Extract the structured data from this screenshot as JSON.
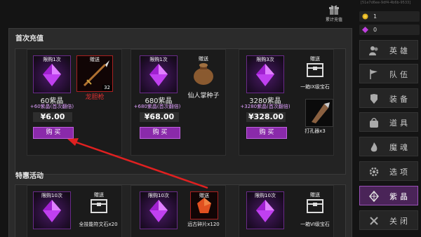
{
  "header": {
    "id_text": "[51e7d6ee-9df4-4b6b-9533]",
    "cumulative_label": "累计充值"
  },
  "currency": [
    {
      "icon": "gold-coin-icon",
      "value": "1"
    },
    {
      "icon": "purple-gem-icon",
      "value": "0"
    }
  ],
  "sections": [
    {
      "title": "首次充值"
    },
    {
      "title": "特惠活动"
    }
  ],
  "first_recharge": [
    {
      "limit": "限购1次",
      "gem_name": "60紫晶",
      "gem_sub": "+60紫晶(首次翻倍)",
      "price": "¥6.00",
      "buy": "购 买",
      "gifts": [
        {
          "tag": "赠送",
          "qty": "32",
          "name": "龙胆枪",
          "icon": "spear-icon"
        }
      ]
    },
    {
      "limit": "限购1次",
      "gem_name": "680紫晶",
      "gem_sub": "+680紫晶(首次翻倍)",
      "price": "¥68.00",
      "buy": "购 买",
      "gifts": [
        {
          "tag": "赠送",
          "qty": "",
          "name": "仙人掌种子",
          "icon": "seed-bag-icon"
        }
      ]
    },
    {
      "limit": "限购3次",
      "gem_name": "3280紫晶",
      "gem_sub": "+3280紫晶(首次翻倍)",
      "price": "¥328.00",
      "buy": "购 买",
      "gifts": [
        {
          "tag": "赠送",
          "qty": "",
          "name": "一箱IX级宝石",
          "icon": "chest-icon"
        },
        {
          "tag": "",
          "qty": "",
          "name": "打孔器x3",
          "icon": "driller-icon"
        }
      ]
    }
  ],
  "specials": [
    {
      "limit": "限购10次",
      "gift_tag": "赠送",
      "gift_name": "全技能符文石x20",
      "gift_icon": "chest-icon"
    },
    {
      "limit": "限购10次",
      "gift_tag": "赠送",
      "gift_name": "远古碎片x120",
      "gift_icon": "shard-icon"
    },
    {
      "limit": "限购10次",
      "gift_tag": "赠送",
      "gift_name": "一箱VI级宝石",
      "gift_icon": "chest-icon"
    }
  ],
  "sidebar": [
    {
      "label": "英雄",
      "icon": "heroes-icon",
      "active": false
    },
    {
      "label": "队伍",
      "icon": "flag-icon",
      "active": false
    },
    {
      "label": "装备",
      "icon": "armor-icon",
      "active": false
    },
    {
      "label": "道具",
      "icon": "bag-icon",
      "active": false
    },
    {
      "label": "魔魂",
      "icon": "flame-icon",
      "active": false
    },
    {
      "label": "选项",
      "icon": "gear-icon",
      "active": false
    },
    {
      "label": "紫晶",
      "icon": "crystal-icon",
      "active": true
    },
    {
      "label": "关闭",
      "icon": "close-icon",
      "active": false
    }
  ],
  "colors": {
    "accent_purple": "#8a2aaa",
    "gift_red": "#e03030",
    "panel_bg": "#2b2b2b"
  }
}
